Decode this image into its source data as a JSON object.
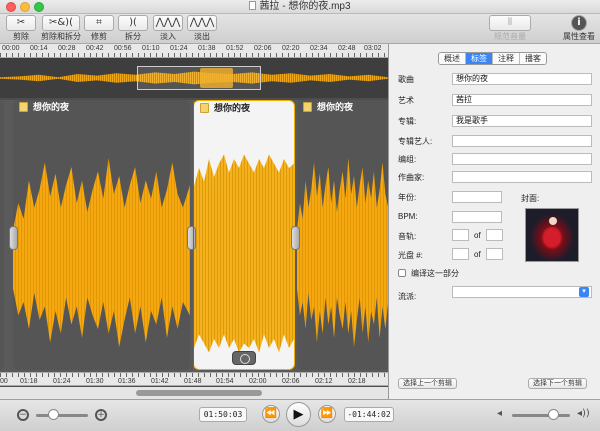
{
  "window": {
    "title": "茜拉 - 想你的夜.mp3"
  },
  "toolbar": {
    "items": [
      {
        "label": "剪除",
        "icon": "✂"
      },
      {
        "label": "剪除和拆分",
        "icon": "✂&)("
      },
      {
        "label": "修剪",
        "icon": "⌗"
      },
      {
        "label": "拆分",
        "icon": ")("
      },
      {
        "label": "淡入",
        "icon": "⋀⋀⋀"
      },
      {
        "label": "淡出",
        "icon": "⋀⋀⋀"
      },
      {
        "label": "规范音量",
        "icon": "⫴"
      },
      {
        "label": "属性查看",
        "icon": "i"
      }
    ]
  },
  "ruler_top": [
    "00:00",
    "00:14",
    "00:28",
    "00:42",
    "00:56",
    "01:10",
    "01:24",
    "01:38",
    "01:52",
    "02:06",
    "02:20",
    "02:34",
    "02:48",
    "03:02"
  ],
  "ruler_bottom": [
    "00",
    "01:18",
    "01:24",
    "01:30",
    "01:36",
    "01:42",
    "01:48",
    "01:54",
    "02:00",
    "02:06",
    "02:12",
    "02:18"
  ],
  "clips": [
    {
      "title": "想你的夜"
    },
    {
      "title": "想你的夜"
    },
    {
      "title": "想你的夜"
    }
  ],
  "inspector": {
    "tabs": [
      "概述",
      "标签",
      "注释",
      "播客"
    ],
    "active_tab": "标签",
    "fields": {
      "title": {
        "label": "歌曲",
        "value": "想你的夜"
      },
      "artist": {
        "label": "艺术",
        "value": "茜拉"
      },
      "album": {
        "label": "专辑:",
        "value": "我是歌手"
      },
      "album_artist": {
        "label": "专辑艺人:",
        "value": ""
      },
      "group": {
        "label": "编组:",
        "value": ""
      },
      "composer": {
        "label": "作曲家:",
        "value": ""
      },
      "year": {
        "label": "年份:",
        "value": ""
      },
      "bpm": {
        "label": "BPM:",
        "value": ""
      },
      "track": {
        "label": "音轨:",
        "value": "",
        "of": "of",
        "total": ""
      },
      "disc": {
        "label": "光盘 #:",
        "value": "",
        "of": "of",
        "total": ""
      },
      "genre": {
        "label": "流派:",
        "value": ""
      }
    },
    "cover_label": "封面:",
    "compilation_label": "编译这一部分",
    "compilation_checked": false,
    "prev_button": "选择上一个剪辑",
    "next_button": "选择下一个剪辑"
  },
  "transport": {
    "current_time": "01:50:03",
    "remaining_time": "-01:44:02",
    "zoom_level": 0.32,
    "volume_level": 0.7
  },
  "colors": {
    "accent": "#3b86f7",
    "waveform": "#f5a80f",
    "playhead": "#d33333"
  }
}
